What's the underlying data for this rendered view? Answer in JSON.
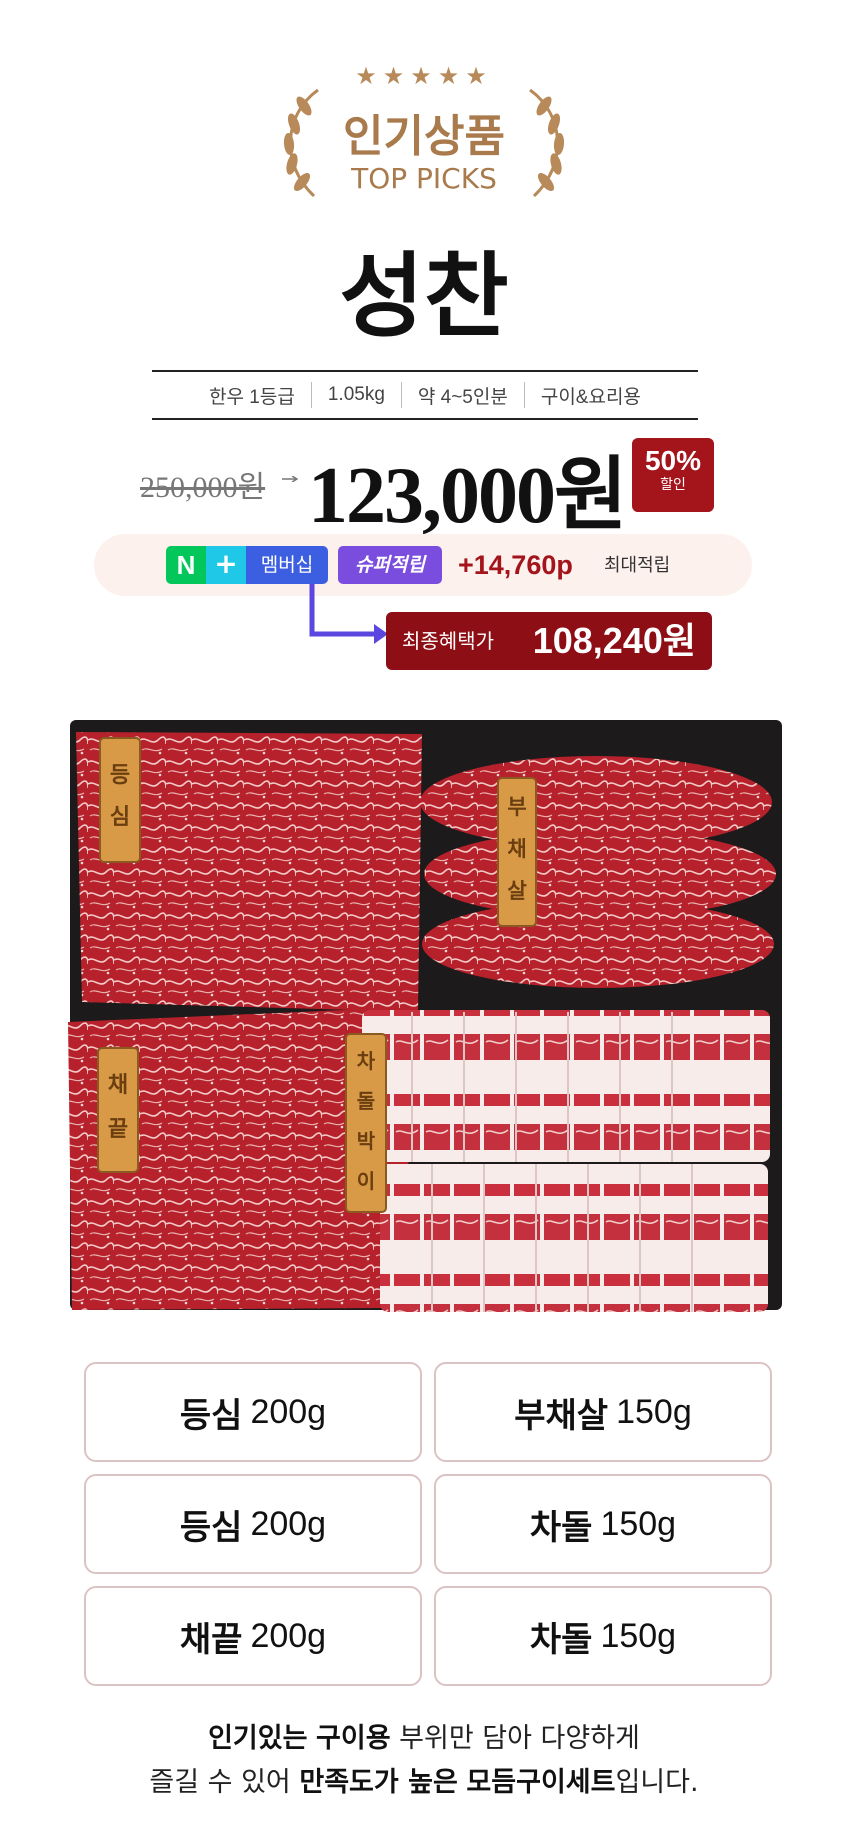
{
  "badge": {
    "stars": "★★★★★",
    "title_ko": "인기상품",
    "title_en": "TOP PICKS",
    "color": "#a87a4c"
  },
  "product": {
    "name": "성찬",
    "specs": [
      "한우 1등급",
      "1.05kg",
      "약 4~5인분",
      "구이&요리용"
    ]
  },
  "price": {
    "original": "250,000원",
    "sale": "123,000원",
    "discount_pct": "50%",
    "discount_label": "할인",
    "discount_color": "#a3141b"
  },
  "benefits": {
    "naver_n": "N",
    "naver_plus": "+",
    "membership": "멤버십",
    "super_label": "슈퍼적립",
    "points": "+14,760p",
    "points_suffix": "최대적립",
    "final_label": "최종혜택가",
    "final_price": "108,240원"
  },
  "image": {
    "tags": [
      "등심",
      "부채살",
      "채끝",
      "차돌박이"
    ]
  },
  "composition": [
    {
      "part": "등심",
      "weight": "200g"
    },
    {
      "part": "부채살",
      "weight": "150g"
    },
    {
      "part": "등심",
      "weight": "200g"
    },
    {
      "part": "차돌",
      "weight": "150g"
    },
    {
      "part": "채끝",
      "weight": "200g"
    },
    {
      "part": "차돌",
      "weight": "150g"
    }
  ],
  "description": {
    "line1_a": "인기있는",
    "line1_b": "구이용",
    "line1_c": "부위만 담아 다양하게",
    "line2_a": "즐길 수 있어",
    "line2_b": "만족도가 높은",
    "line2_c": "모듬구이세트",
    "line2_d": "입니다."
  }
}
